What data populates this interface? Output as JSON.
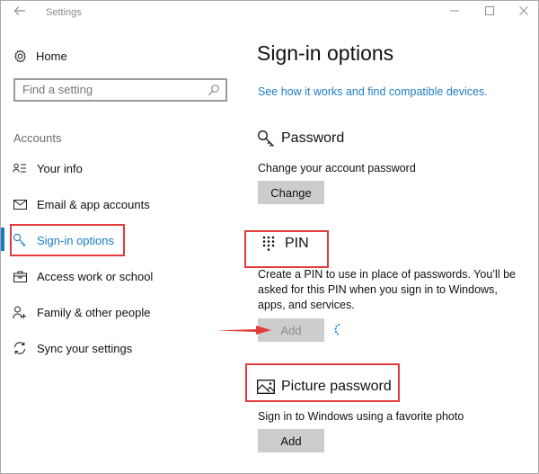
{
  "window": {
    "title": "Settings",
    "back_icon": "back-arrow-icon",
    "controls": {
      "minimize": "–",
      "maximize": "☐",
      "close": "✕"
    }
  },
  "sidebar": {
    "home_label": "Home",
    "search_placeholder": "Find a setting",
    "section_label": "Accounts",
    "items": [
      {
        "label": "Your info",
        "icon": "person-card-icon",
        "selected": false
      },
      {
        "label": "Email & app accounts",
        "icon": "mail-icon",
        "selected": false
      },
      {
        "label": "Sign-in options",
        "icon": "key-icon",
        "selected": true
      },
      {
        "label": "Access work or school",
        "icon": "briefcase-icon",
        "selected": false
      },
      {
        "label": "Family & other people",
        "icon": "person-add-icon",
        "selected": false
      },
      {
        "label": "Sync your settings",
        "icon": "sync-icon",
        "selected": false
      }
    ]
  },
  "main": {
    "title": "Sign-in options",
    "help_link": "See how it works and find compatible devices.",
    "sections": [
      {
        "title": "Password",
        "icon": "key-icon",
        "description": "Change your account password",
        "button": "Change",
        "button_disabled": false
      },
      {
        "title": "PIN",
        "icon": "keypad-icon",
        "description": "Create a PIN to use in place of passwords. You’ll be asked for this PIN when you sign in to Windows, apps, and services.",
        "button": "Add",
        "button_disabled": true,
        "loading": true
      },
      {
        "title": "Picture password",
        "icon": "picture-icon",
        "description": "Sign in to Windows using a favorite photo",
        "button": "Add",
        "button_disabled": false
      }
    ]
  },
  "annotations": {
    "highlight_color": "#e23b3b",
    "accent_color": "#1a7bc1",
    "link_color": "#1f7ec2"
  }
}
